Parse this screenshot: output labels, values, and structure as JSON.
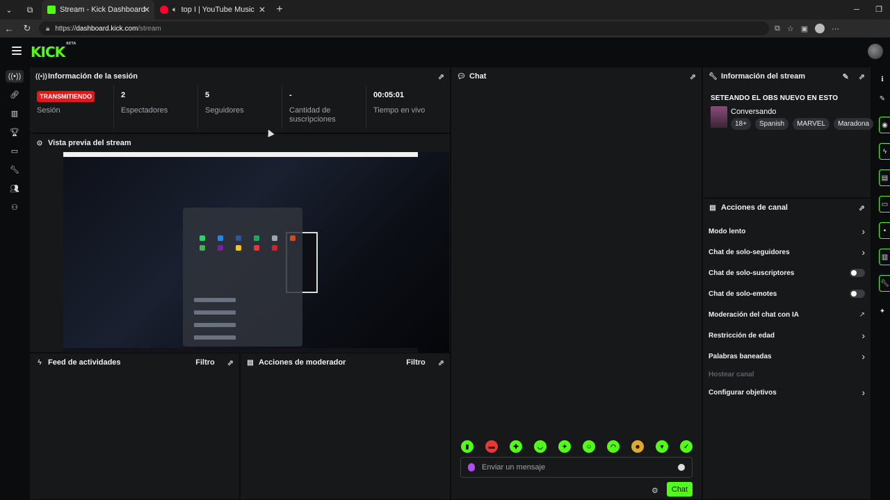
{
  "browser": {
    "tabs": [
      {
        "title": "Stream - Kick Dashboard",
        "favicon_color": "#53fc18",
        "active": true
      },
      {
        "title": "top I | YouTube Music",
        "favicon_color": "#ff0033",
        "active": false,
        "audio_icon": "speaker-icon"
      }
    ],
    "url": {
      "scheme": "https://",
      "host": "dashboard.kick.com",
      "path": "/stream"
    }
  },
  "app": {
    "brand": "KICK",
    "brand_suffix": "BETA",
    "accent_color": "#53fc18",
    "sidebar_icons": [
      "broadcast-icon",
      "link-icon",
      "analytics-icon",
      "trophy-icon",
      "monitor-icon",
      "wrench-icon",
      "users-icon",
      "community-icon"
    ],
    "right_rail_icons": [
      "edit-icon",
      "camera-icon",
      "bolt-icon",
      "note-icon",
      "chat-icon",
      "broadcast-icon",
      "layout-icon",
      "wrench-icon",
      "sparkle-icon"
    ]
  },
  "session": {
    "title": "Información de la sesión",
    "status_badge": "TRANSMITIENDO",
    "status_color": "#e31919",
    "stats": [
      {
        "value": "",
        "label": "Sesión"
      },
      {
        "value": "2",
        "label": "Espectadores"
      },
      {
        "value": "5",
        "label": "Seguidores"
      },
      {
        "value": "-",
        "label": "Cantidad de suscripciones"
      },
      {
        "value": "00:05:01",
        "label": "Tiempo en vivo"
      }
    ]
  },
  "preview": {
    "title": "Vista previa del stream"
  },
  "activity_feed": {
    "title": "Feed de actividades",
    "filter": "Filtro"
  },
  "mod_actions": {
    "title": "Acciones de moderador",
    "filter": "Filtro"
  },
  "chat": {
    "title": "Chat",
    "input_placeholder": "Enviar un mensaje",
    "send_label": "Chat",
    "emotes": [
      "emote-1",
      "emote-2",
      "emote-3",
      "emote-4",
      "emote-5",
      "emote-6",
      "emote-7",
      "emote-8",
      "emote-9",
      "emote-10"
    ]
  },
  "stream_info": {
    "title": "Información del stream",
    "stream_title": "SETEANDO EL OBS NUEVO EN ESTO",
    "category": "Conversando",
    "tags": [
      "18+",
      "Spanish",
      "MARVEL",
      "Maradona"
    ]
  },
  "channel_actions": {
    "title": "Acciones de canal",
    "items": [
      {
        "label": "Modo lento",
        "control": "chevron"
      },
      {
        "label": "Chat de solo-seguidores",
        "control": "chevron"
      },
      {
        "label": "Chat de solo-suscriptores",
        "control": "toggle",
        "on": false
      },
      {
        "label": "Chat de solo-emotes",
        "control": "toggle",
        "on": false
      },
      {
        "label": "Moderación del chat con IA",
        "control": "external"
      },
      {
        "label": "Restricción de edad",
        "control": "chevron"
      },
      {
        "label": "Palabras baneadas",
        "control": "chevron"
      },
      {
        "label": "Hostear canal",
        "control": "disabled"
      },
      {
        "label": "Configurar objetivos",
        "control": "chevron"
      }
    ]
  }
}
